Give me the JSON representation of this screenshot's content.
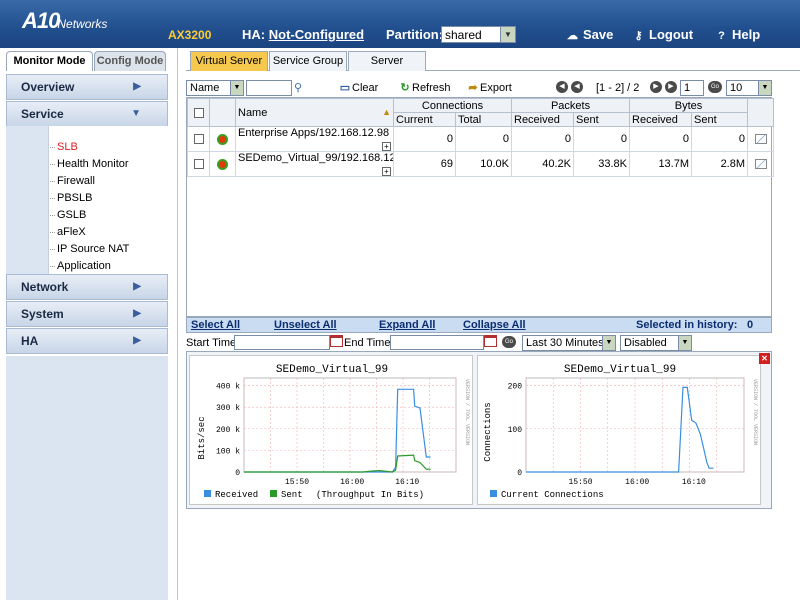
{
  "header": {
    "logo_big": "A10",
    "logo_small": "Networks",
    "model": "AX3200",
    "ha_label": "HA:",
    "ha_value": "Not-Configured",
    "partition_label": "Partition:",
    "partition_value": "shared",
    "save": "Save",
    "logout": "Logout",
    "help": "Help"
  },
  "mode_tabs": {
    "monitor": "Monitor Mode",
    "config": "Config Mode"
  },
  "nav": {
    "overview": "Overview",
    "service": "Service",
    "network": "Network",
    "system": "System",
    "ha": "HA",
    "service_items": [
      "SLB",
      "Health Monitor",
      "Firewall",
      "PBSLB",
      "GSLB",
      "aFleX",
      "IP Source NAT",
      "Application"
    ]
  },
  "main_tabs": [
    "Virtual Server",
    "Service Group",
    "Server"
  ],
  "toolbar": {
    "filter_field": "Name",
    "clear": "Clear",
    "refresh": "Refresh",
    "export": "Export",
    "page_range": "[1 - 2] / 2",
    "page_input": "1",
    "go": "Go",
    "page_size": "10"
  },
  "table": {
    "col_name": "Name",
    "group_connections": "Connections",
    "group_packets": "Packets",
    "group_bytes": "Bytes",
    "sub_current": "Current",
    "sub_total": "Total",
    "sub_received": "Received",
    "sub_sent": "Sent",
    "rows": [
      {
        "name": "Enterprise Apps/192.168.12.98",
        "conn_current": "0",
        "conn_total": "0",
        "pkt_received": "0",
        "pkt_sent": "0",
        "bytes_received": "0",
        "bytes_sent": "0"
      },
      {
        "name": "SEDemo_Virtual_99/192.168.12.99",
        "conn_current": "69",
        "conn_total": "10.0K",
        "pkt_received": "40.2K",
        "pkt_sent": "33.8K",
        "bytes_received": "13.7M",
        "bytes_sent": "2.8M"
      }
    ]
  },
  "grid_footer": {
    "select_all": "Select All",
    "unselect_all": "Unselect All",
    "expand_all": "Expand All",
    "collapse_all": "Collapse All",
    "selected_label": "Selected in history:",
    "selected_count": "0"
  },
  "timebar": {
    "start_label": "Start Time:",
    "end_label": "End Time:",
    "range": "Last 30 Minutes",
    "refresh_mode": "Disabled"
  },
  "charts": [
    {
      "title": "SEDemo_Virtual_99",
      "ylabel": "Bits/sec",
      "side_label": "VERSION / TOOL VERSION",
      "yticks": [
        "0",
        "100 k",
        "200 k",
        "300 k",
        "400 k"
      ],
      "xticks": [
        "15:50",
        "16:00",
        "16:10"
      ],
      "legend": [
        {
          "label": "Received",
          "color": "#3a8ee0"
        },
        {
          "label": "Sent",
          "color": "#2a9a2a"
        }
      ],
      "legend_note": "(Throughput In Bits)"
    },
    {
      "title": "SEDemo_Virtual_99",
      "ylabel": "Connections",
      "side_label": "VERSION / TOOL VERSION",
      "yticks": [
        "0",
        "100",
        "200"
      ],
      "xticks": [
        "15:50",
        "16:00",
        "16:10"
      ],
      "legend": [
        {
          "label": "Current Connections",
          "color": "#3a8ee0"
        }
      ]
    }
  ]
}
